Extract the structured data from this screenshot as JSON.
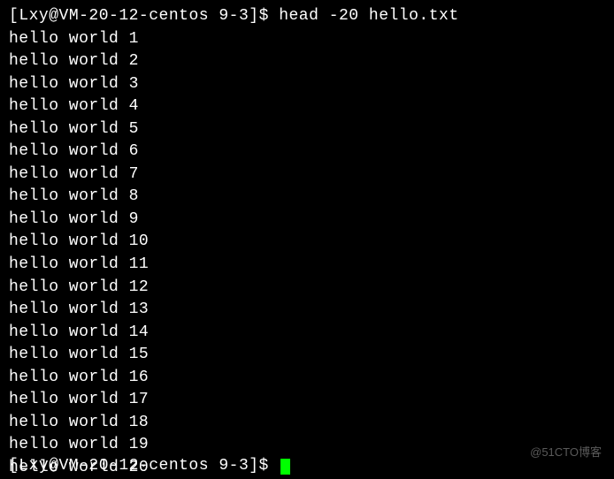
{
  "terminal": {
    "prompt_open": "[",
    "prompt_user": "Lxy@VM-20-12-centos",
    "prompt_dir": "9-3",
    "prompt_close": "]$",
    "command": "head -20 hello.txt",
    "output_lines": [
      "hello world 1",
      "hello world 2",
      "hello world 3",
      "hello world 4",
      "hello world 5",
      "hello world 6",
      "hello world 7",
      "hello world 8",
      "hello world 9",
      "hello world 10",
      "hello world 11",
      "hello world 12",
      "hello world 13",
      "hello world 14",
      "hello world 15",
      "hello world 16",
      "hello world 17",
      "hello world 18",
      "hello world 19",
      "hello world 20"
    ],
    "prompt2_partial": "[Lxy@VM-20-12-centos 9-3]$"
  },
  "watermark": "@51CTO博客"
}
